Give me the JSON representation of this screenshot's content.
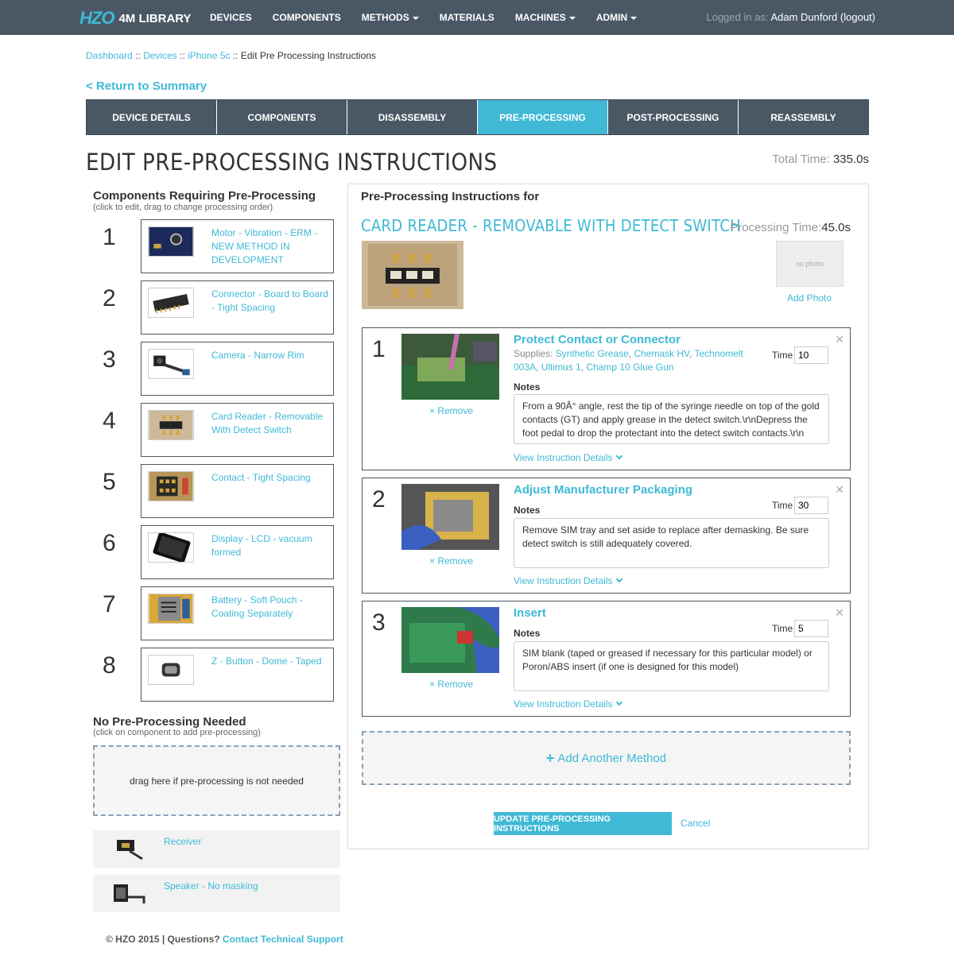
{
  "nav": {
    "logo_mark": "HZO",
    "logo_text": "4M LIBRARY",
    "items": [
      {
        "label": "DEVICES",
        "dropdown": false
      },
      {
        "label": "COMPONENTS",
        "dropdown": false
      },
      {
        "label": "METHODS",
        "dropdown": true
      },
      {
        "label": "MATERIALS",
        "dropdown": false
      },
      {
        "label": "MACHINES",
        "dropdown": true
      },
      {
        "label": "ADMIN",
        "dropdown": true
      }
    ],
    "logged_in_prefix": "Logged in as:",
    "user": "Adam Dunford",
    "logout": "(logout)"
  },
  "breadcrumb": {
    "items": [
      "Dashboard",
      "Devices",
      "iPhone 5c"
    ],
    "current": "Edit Pre Processing Instructions",
    "separator": "::"
  },
  "return_link": "< Return to Summary",
  "tabs": [
    {
      "label": "DEVICE DETAILS",
      "active": false
    },
    {
      "label": "COMPONENTS",
      "active": false
    },
    {
      "label": "DISASSEMBLY",
      "active": false
    },
    {
      "label": "PRE-PROCESSING",
      "active": true
    },
    {
      "label": "POST-PROCESSING",
      "active": false
    },
    {
      "label": "REASSEMBLY",
      "active": false
    }
  ],
  "page_title": "EDIT PRE-PROCESSING INSTRUCTIONS",
  "total_time": {
    "label": "Total Time:",
    "value": "335.0s"
  },
  "left": {
    "heading": "Components Requiring Pre-Processing",
    "sub": "(click to edit, drag to change processing order)",
    "components": [
      {
        "num": "1",
        "label": "Motor - Vibration - ERM - NEW METHOD IN DEVELOPMENT",
        "icon": "motor-thumb"
      },
      {
        "num": "2",
        "label": "Connector - Board to Board - Tight Spacing",
        "icon": "connector-thumb"
      },
      {
        "num": "3",
        "label": "Camera - Narrow Rim",
        "icon": "camera-thumb"
      },
      {
        "num": "4",
        "label": "Card Reader - Removable With Detect Switch",
        "icon": "card-reader-thumb"
      },
      {
        "num": "5",
        "label": "Contact - Tight Spacing",
        "icon": "contact-thumb"
      },
      {
        "num": "6",
        "label": "Display - LCD - vacuum formed",
        "icon": "display-thumb"
      },
      {
        "num": "7",
        "label": "Battery - Soft Pouch - Coating Separately",
        "icon": "battery-thumb"
      },
      {
        "num": "8",
        "label": "Z - Button - Dome - Taped",
        "icon": "button-thumb"
      }
    ],
    "no_pre_heading": "No Pre-Processing Needed",
    "no_pre_sub": "(click on component to add pre-processing)",
    "dropzone_text": "drag here if pre-processing is not needed",
    "no_pre_items": [
      {
        "label": "Receiver"
      },
      {
        "label": "Speaker - No masking"
      }
    ]
  },
  "right": {
    "heading": "Pre-Processing Instructions for",
    "component_title": "CARD READER - REMOVABLE WITH DETECT SWITCH",
    "processing_time": {
      "label": "Processing Time:",
      "value": "45.0s"
    },
    "no_photo": "no photo",
    "add_photo": "Add Photo",
    "steps": [
      {
        "num": "1",
        "title": "Protect Contact or Connector",
        "supplies_label": "Supplies:",
        "supplies": [
          "Synthetic Grease",
          "Chemask HV",
          "Technomelt 003A",
          "Ultimus 1",
          "Champ 10 Glue Gun"
        ],
        "time_label": "Time",
        "time": "10",
        "notes_label": "Notes",
        "notes": "From a 90Â° angle, rest the tip of the syringe needle on top of the gold contacts (GT) and apply grease in the detect switch.\\r\\nDepress the foot pedal to drop the protectant into the detect switch contacts.\\r\\n",
        "remove": "× Remove",
        "details": "View Instruction Details"
      },
      {
        "num": "2",
        "title": "Adjust Manufacturer Packaging",
        "time_label": "Time",
        "time": "30",
        "notes_label": "Notes",
        "notes": "Remove SIM tray and set aside to replace after demasking.  Be sure detect switch is still adequately covered.",
        "remove": "× Remove",
        "details": "View Instruction Details"
      },
      {
        "num": "3",
        "title": "Insert",
        "time_label": "Time",
        "time": "5",
        "notes_label": "Notes",
        "notes": "SIM blank (taped or greased if necessary for this particular model) or Poron/ABS insert (if one is designed for this model)",
        "remove": "× Remove",
        "details": "View Instruction Details"
      }
    ],
    "add_method": "Add Another Method",
    "update_button": "UPDATE PRE-PROCESSING INSTRUCTIONS",
    "cancel": "Cancel"
  },
  "footer": {
    "copyright": "© HZO 2015 | Questions?",
    "link": "Contact Technical Support"
  },
  "colors": {
    "accent": "#3fb9d6",
    "nav": "#4a5866"
  }
}
